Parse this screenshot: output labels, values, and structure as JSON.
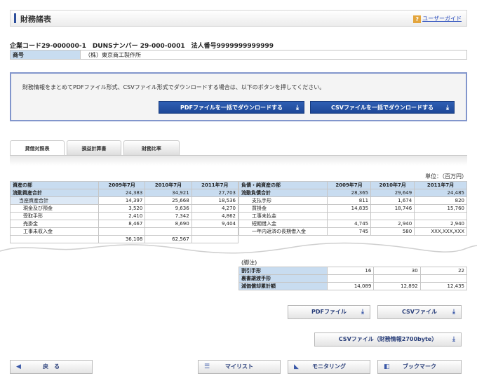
{
  "header": {
    "title": "財務諸表",
    "guide_icon": "?",
    "guide_label": "ユーザーガイド"
  },
  "company": {
    "code_line": "企業コード29-000000-1　DUNSナンバー 29-000-0001　法人番号9999999999999",
    "name_label": "商号",
    "name_value": "（株）東京商工製作所"
  },
  "download": {
    "message": "財務情報をまとめてPDFファイル形式、CSVファイル形式でダウンロードする場合は、以下のボタンを押してください。",
    "pdf_all_label": "PDFファイルを一括でダウンロードする",
    "csv_all_label": "CSVファイルを一括でダウンロードする"
  },
  "tabs": [
    "貸借対照表",
    "損益計算書",
    "財務比率"
  ],
  "unit": "単位：（百万円）",
  "bs_left": {
    "headers": [
      "資産の部",
      "2009年7月",
      "2010年7月",
      "2011年7月"
    ],
    "rows": [
      [
        "流動資産合計",
        "24,383",
        "34,921",
        "27,703"
      ],
      [
        "当座資産合計",
        "14,397",
        "25,668",
        "18,536"
      ],
      [
        "現金及び預金",
        "3,520",
        "9,636",
        "4,270"
      ],
      [
        "受取手形",
        "2,410",
        "7,342",
        "4,862"
      ],
      [
        "売掛金",
        "8,467",
        "8,690",
        "9,404"
      ],
      [
        "工事未収入金",
        "",
        "",
        ""
      ],
      [
        "",
        "36,108",
        "62,567",
        ""
      ]
    ]
  },
  "bs_right": {
    "headers": [
      "負債・純資産の部",
      "2009年7月",
      "2010年7月",
      "2011年7月"
    ],
    "rows": [
      [
        "流動負債合計",
        "28,365",
        "29,649",
        "24,485"
      ],
      [
        "支払手形",
        "811",
        "1,674",
        "820"
      ],
      [
        "買掛金",
        "14,835",
        "18,746",
        "15,760"
      ],
      [
        "工事未払金",
        "",
        "",
        ""
      ],
      [
        "短期借入金",
        "4,745",
        "2,940",
        "2,940"
      ],
      [
        "一年内返済の長期借入金",
        "745",
        "580",
        "XXX,XXX,XXX"
      ]
    ]
  },
  "notes": {
    "title": "(脚注)",
    "rows": [
      [
        "割引手形",
        "16",
        "30",
        "22"
      ],
      [
        "裏書譲渡手形",
        "",
        "",
        ""
      ],
      [
        "減価償却累計額",
        "14,089",
        "12,892",
        "12,435"
      ]
    ]
  },
  "buttons": {
    "pdf": "PDFファイル",
    "csv": "CSVファイル",
    "csv_fin": "CSVファイル（財務情報2700byte）",
    "back": "戻　る",
    "mylist": "マイリスト",
    "monitoring": "モニタリング",
    "bookmark": "ブックマーク"
  },
  "colors": {
    "accent": "#2d4f9c",
    "table_header": "#c8dcf0",
    "download_button": "#1e4897"
  }
}
